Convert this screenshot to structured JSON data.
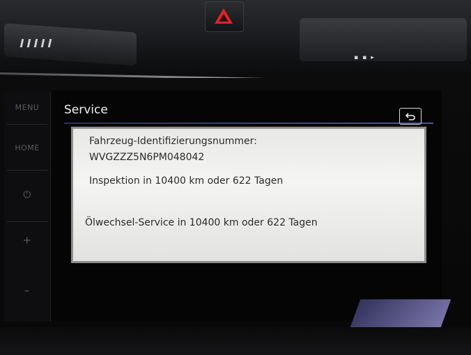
{
  "sidebar": {
    "menu_label": "MENU",
    "home_label": "HOME",
    "power_symbol": "⏻",
    "plus_symbol": "+",
    "minus_symbol": "–"
  },
  "screen": {
    "title": "Service",
    "back_icon": "back-arrow-icon",
    "vin_label": "Fahrzeug-Identifizierungsnummer:",
    "vin_value": "WVGZZZ5N6PM048042",
    "inspection": "Inspektion in 10400 km oder 622 Tagen",
    "oil_service": "Ölwechsel-Service in 10400 km oder 622 Tagen"
  },
  "colors": {
    "accent_line": "#4a4fb0",
    "hazard": "#e0242b",
    "panel": "#efefed"
  }
}
